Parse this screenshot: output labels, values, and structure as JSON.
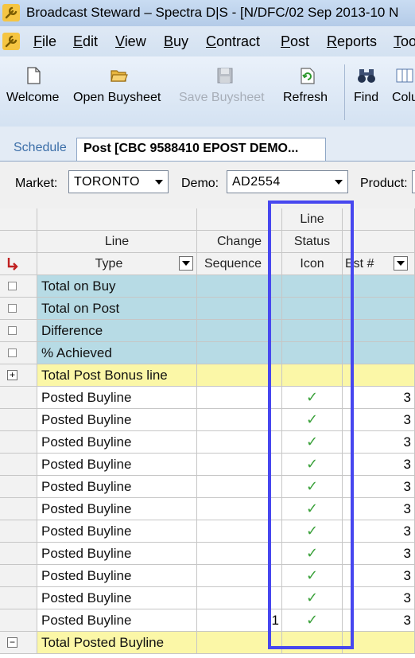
{
  "window": {
    "title": "Broadcast Steward – Spectra D|S - [N/DFC/02 Sep 2013-10 N"
  },
  "menu": [
    "File",
    "Edit",
    "View",
    "Buy",
    "Contract",
    "Post",
    "Reports",
    "Too"
  ],
  "toolbar": {
    "buttons": [
      {
        "label": "Welcome",
        "icon": "new-document-icon",
        "enabled": true
      },
      {
        "label": "Open Buysheet",
        "icon": "open-folder-icon",
        "enabled": true
      },
      {
        "label": "Save Buysheet",
        "icon": "save-disk-icon",
        "enabled": false
      },
      {
        "label": "Refresh",
        "icon": "refresh-icon",
        "enabled": true
      },
      {
        "label": "Find",
        "icon": "binoculars-icon",
        "enabled": true
      },
      {
        "label": "Colu",
        "icon": "columns-icon",
        "enabled": true
      }
    ]
  },
  "tabs": [
    {
      "label": "Schedule",
      "active": false
    },
    {
      "label": "Post [CBC 9588410 EPOST DEMO...",
      "active": true
    }
  ],
  "filters": {
    "market_label": "Market:",
    "market_value": "TORONTO",
    "demo_label": "Demo:",
    "demo_value": "AD2554",
    "product_label": "Product:"
  },
  "grid": {
    "headers": {
      "line_type": [
        "Line",
        "Type"
      ],
      "change_sequence": [
        "Change",
        "Sequence"
      ],
      "line_status_icon": [
        "Line",
        "Status",
        "Icon"
      ],
      "est_no": "Est #"
    },
    "summary_rows": [
      {
        "label": "Total on Buy",
        "style": "blue",
        "control": "checkbox"
      },
      {
        "label": "Total on Post",
        "style": "blue",
        "control": "checkbox"
      },
      {
        "label": "Difference",
        "style": "blue",
        "control": "checkbox"
      },
      {
        "label": "% Achieved",
        "style": "blue",
        "control": "checkbox"
      },
      {
        "label": "Total Post Bonus line",
        "style": "yellow",
        "control": "expand-plus"
      }
    ],
    "buyline_rows": [
      {
        "type": "Posted Buyline",
        "sequence": "",
        "status": "✓",
        "est": "3"
      },
      {
        "type": "Posted Buyline",
        "sequence": "",
        "status": "✓",
        "est": "3"
      },
      {
        "type": "Posted Buyline",
        "sequence": "",
        "status": "✓",
        "est": "3"
      },
      {
        "type": "Posted Buyline",
        "sequence": "",
        "status": "✓",
        "est": "3"
      },
      {
        "type": "Posted Buyline",
        "sequence": "",
        "status": "✓",
        "est": "3"
      },
      {
        "type": "Posted Buyline",
        "sequence": "",
        "status": "✓",
        "est": "3"
      },
      {
        "type": "Posted Buyline",
        "sequence": "",
        "status": "✓",
        "est": "3"
      },
      {
        "type": "Posted Buyline",
        "sequence": "",
        "status": "✓",
        "est": "3"
      },
      {
        "type": "Posted Buyline",
        "sequence": "",
        "status": "✓",
        "est": "3"
      },
      {
        "type": "Posted Buyline",
        "sequence": "",
        "status": "✓",
        "est": "3"
      },
      {
        "type": "Posted Buyline",
        "sequence": "1",
        "status": "✓",
        "est": "3"
      }
    ],
    "footer_row": {
      "label": "Total Posted Buyline",
      "style": "yellow",
      "control": "expand-minus"
    }
  },
  "colors": {
    "summary_blue": "#b7dbe5",
    "summary_yellow": "#fbf7a7",
    "status_check": "#3aa13a",
    "highlight": "#4747ef"
  }
}
